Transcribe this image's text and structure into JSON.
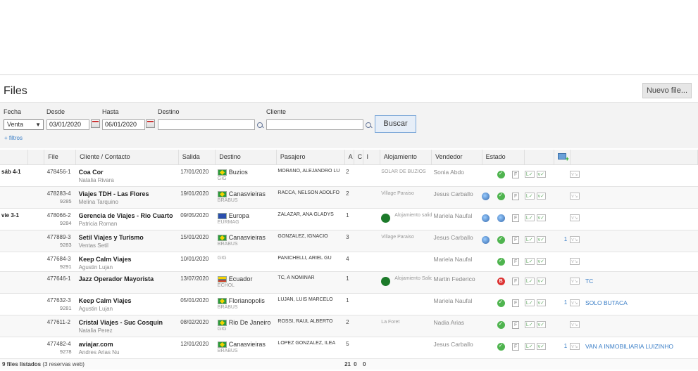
{
  "page": {
    "title": "Files",
    "new_button": "Nuevo file..."
  },
  "filters": {
    "fecha_label": "Fecha",
    "fecha_value": "Venta",
    "desde_label": "Desde",
    "desde_value": "03/01/2020",
    "hasta_label": "Hasta",
    "hasta_value": "06/01/2020",
    "destino_label": "Destino",
    "cliente_label": "Cliente",
    "search_button": "Buscar",
    "more_filters": "+ filtros"
  },
  "columns": [
    "File",
    "Cliente / Contacto",
    "Salida",
    "Destino",
    "Pasajero",
    "A",
    "C",
    "I",
    "Alojamiento",
    "Vendedor",
    "Estado"
  ],
  "rows": [
    {
      "day": "sáb 4-1",
      "file": "478456-1",
      "code": "",
      "client": "Coa Cor",
      "contact": "Natalia Rivara",
      "salida": "17/01/2020",
      "flag": "br",
      "destino": "Buzios",
      "dsub": "GIG",
      "pax": "MORANO, ALEJANDRO LU",
      "a": "2",
      "aloj": "SOLAR DE BUZIOS",
      "people": false,
      "vendedor": "Sonia Abdo",
      "globe": false,
      "status": "ok",
      "num": "",
      "note": ""
    },
    {
      "day": "",
      "file": "478283-4",
      "code": "9285",
      "client": "Viajes TDH - Las Flores",
      "contact": "Melina Tarquino",
      "salida": "19/01/2020",
      "flag": "br",
      "destino": "Canasvieiras",
      "dsub": "BRABUS",
      "pax": "RACCA, NELSON ADOLFO",
      "a": "2",
      "aloj": "Village Paraiso",
      "people": false,
      "vendedor": "Jesus Carballo",
      "globe": true,
      "status": "ok",
      "num": "",
      "note": ""
    },
    {
      "day": "vie 3-1",
      "file": "478066-2",
      "code": "9284",
      "client": "Gerencia de Viajes - Rio Cuarto",
      "contact": "Patricia Roman",
      "salida": "09/05/2020",
      "flag": "eu",
      "destino": "Europa",
      "dsub": "EURMAG",
      "pax": "ZALAZAR, ANA GLADYS",
      "a": "1",
      "aloj": "Alojamiento salida G...",
      "people": true,
      "vendedor": "Mariela Naufal",
      "globe": true,
      "status": "globe",
      "num": "",
      "note": ""
    },
    {
      "day": "",
      "file": "477889-3",
      "code": "9283",
      "client": "Setil Viajes y Turismo",
      "contact": "Ventas Setil",
      "salida": "15/01/2020",
      "flag": "br",
      "destino": "Canasvieiras",
      "dsub": "BRABUS",
      "pax": "GONZALEZ, IGNACIO",
      "a": "3",
      "aloj": "Village Paraiso",
      "people": false,
      "vendedor": "Jesus Carballo",
      "globe": true,
      "status": "ok",
      "num": "1",
      "note": ""
    },
    {
      "day": "",
      "file": "477684-3",
      "code": "9291",
      "client": "Keep Calm Viajes",
      "contact": "Agustin Lujan",
      "salida": "10/01/2020",
      "flag": "",
      "destino": "GIG",
      "dsub": "",
      "pax": "PANICHELLI, ARIEL GU",
      "a": "4",
      "aloj": "",
      "people": false,
      "vendedor": "Mariela Naufal",
      "globe": false,
      "status": "ok",
      "num": "",
      "note": ""
    },
    {
      "day": "",
      "file": "477646-1",
      "code": "",
      "client": "Jazz Operador Mayorista",
      "contact": "",
      "salida": "13/07/2020",
      "flag": "ec",
      "destino": "Ecuador",
      "dsub": "ECHOL",
      "pax": "TC, A NOMINAR",
      "a": "1",
      "aloj": "Alojamiento Salida G...",
      "people": true,
      "vendedor": "Martin Federico",
      "globe": false,
      "status": "bad",
      "num": "",
      "note": "TC"
    },
    {
      "day": "",
      "file": "477632-3",
      "code": "9281",
      "client": "Keep Calm Viajes",
      "contact": "Agustin Lujan",
      "salida": "05/01/2020",
      "flag": "br",
      "destino": "Florianopolis",
      "dsub": "BRABUS",
      "pax": "LUJAN, LUIS MARCELO",
      "a": "1",
      "aloj": "",
      "people": false,
      "vendedor": "Mariela Naufal",
      "globe": false,
      "status": "ok",
      "num": "1",
      "note": "SOLO BUTACA"
    },
    {
      "day": "",
      "file": "477611-2",
      "code": "",
      "client": "Cristal Viajes - Suc Cosquin",
      "contact": "Natalia Perez",
      "salida": "08/02/2020",
      "flag": "br",
      "destino": "Rio De Janeiro",
      "dsub": "GIG",
      "pax": "ROSSI, RAUL ALBERTO",
      "a": "2",
      "aloj": "La Foret",
      "people": false,
      "vendedor": "Nadia Arias",
      "globe": false,
      "status": "ok",
      "num": "",
      "note": ""
    },
    {
      "day": "",
      "file": "477482-4",
      "code": "9278",
      "client": "aviajar.com",
      "contact": "Andres Arias Nu",
      "salida": "12/01/2020",
      "flag": "br",
      "destino": "Canasvieiras",
      "dsub": "BRABUS",
      "pax": "LOPEZ GONZALEZ, ILEA",
      "a": "5",
      "aloj": "",
      "people": false,
      "vendedor": "Jesus Carballo",
      "globe": false,
      "status": "ok",
      "num": "1",
      "note": "VAN A INMOBILIARIA LUIZINHO"
    }
  ],
  "footer": {
    "summary": "9 files listados",
    "summary_sub": "(3 reservas web)",
    "total_a": "21",
    "total_c": "0",
    "total_i": "0"
  }
}
